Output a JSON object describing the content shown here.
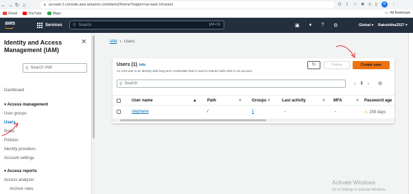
{
  "browser": {
    "url": "us-east-1.console.aws.amazon.com/iamv2/home?region=us-east-1#/users",
    "profile_initial": "R",
    "bookmarks": [
      {
        "label": "Gmail",
        "color": "#ea4335"
      },
      {
        "label": "YouTube",
        "color": "#ff0000"
      },
      {
        "label": "Maps",
        "color": "#34a853"
      }
    ],
    "all_bookmarks": "All Bookmark"
  },
  "aws_nav": {
    "logo": "aws",
    "services": "Services",
    "search_placeholder": "Search",
    "search_shortcut": "[Alt+S]",
    "region": "Global ▾",
    "user": "Rakshitha2527 ▾"
  },
  "sidebar": {
    "title": "Identity and Access Management (IAM)",
    "search_placeholder": "Search IAM",
    "dashboard": "Dashboard",
    "access_management": "Access management",
    "items": [
      "User groups",
      "Users",
      "Roles",
      "Policies",
      "Identity providers",
      "Account settings"
    ],
    "access_reports": "Access reports",
    "report_items": [
      "Access analyzer",
      "Archive rules"
    ]
  },
  "breadcrumb": {
    "root": "IAM",
    "current": "Users"
  },
  "panel": {
    "title": "Users (1)",
    "info": "Info",
    "description": "An IAM user is an identity with long-term credentials that is used to interact with AWS in an account.",
    "delete_label": "Delete",
    "create_label": "Create user",
    "search_placeholder": "Search",
    "page": "1"
  },
  "table": {
    "headers": [
      "User name",
      "Path",
      "Groups",
      "Last activity",
      "MFA",
      "Password age"
    ],
    "rows": [
      {
        "user": "stephane",
        "path": "/",
        "groups": "1",
        "last_activity": "-",
        "mfa": "-",
        "password_age": "158 days"
      }
    ]
  },
  "watermark": {
    "title": "Activate Windows",
    "subtitle": "Go to Settings to activate Windows."
  },
  "colors": {
    "accent": "#ec7211",
    "link": "#0073bb",
    "nav": "#232f3e",
    "annotation": "#e0202a"
  }
}
